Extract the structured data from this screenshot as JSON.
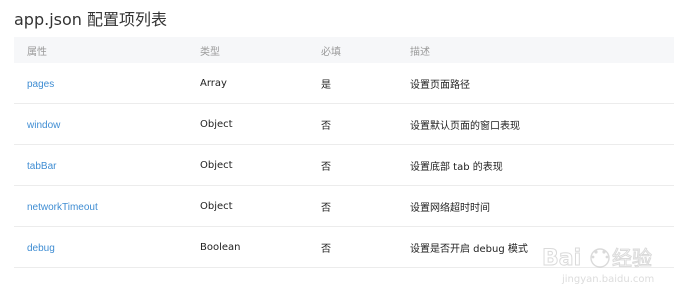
{
  "title": "app.json 配置项列表",
  "table": {
    "headers": [
      "属性",
      "类型",
      "必填",
      "描述"
    ],
    "rows": [
      {
        "property": "pages",
        "type": "Array",
        "required": "是",
        "description": "设置页面路径"
      },
      {
        "property": "window",
        "type": "Object",
        "required": "否",
        "description": "设置默认页面的窗口表现"
      },
      {
        "property": "tabBar",
        "type": "Object",
        "required": "否",
        "description": "设置底部 tab 的表现"
      },
      {
        "property": "networkTimeout",
        "type": "Object",
        "required": "否",
        "description": "设置网络超时时间"
      },
      {
        "property": "debug",
        "type": "Boolean",
        "required": "否",
        "description": "设置是否开启 debug 模式"
      }
    ]
  },
  "watermark": {
    "text": "Baidu经验",
    "url": "jingyan.baidu.com"
  },
  "colors": {
    "link": "#3f8dd3",
    "header_bg": "#f6f7f9"
  }
}
